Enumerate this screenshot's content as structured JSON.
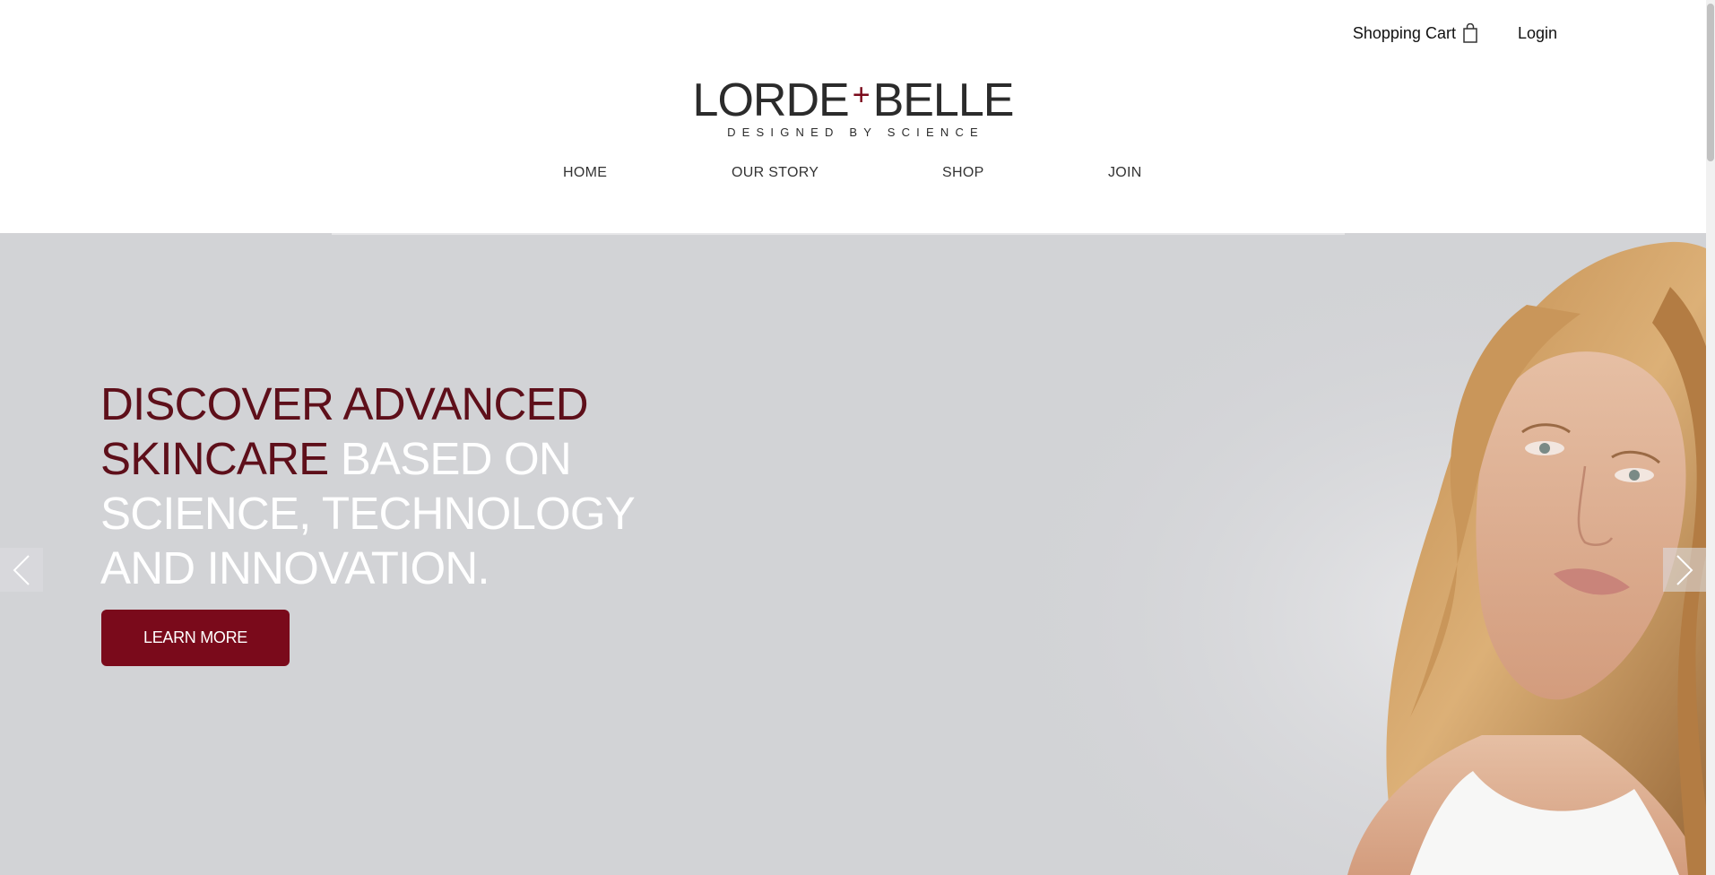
{
  "header": {
    "cart_label": "Shopping Cart",
    "login_label": "Login",
    "logo": {
      "main_left": "LORDE",
      "plus": "+",
      "main_right": "BELLE",
      "tagline": "DESIGNED BY SCIENCE"
    }
  },
  "nav": {
    "items": [
      {
        "label": "HOME"
      },
      {
        "label": "OUR STORY"
      },
      {
        "label": "SHOP"
      },
      {
        "label": "JOIN"
      }
    ]
  },
  "hero": {
    "headline_dark": "DISCOVER ADVANCED SKINCARE",
    "headline_light": " BASED ON SCIENCE, TECHNOLOGY AND INNOVATION.",
    "cta_label": "LEARN MORE"
  },
  "colors": {
    "brand": "#7a0a1b",
    "headline_dark": "#5e0f1a",
    "hero_bg": "#d2d3d6"
  },
  "icons": {
    "cart": "shopping-bag-icon",
    "prev": "chevron-left-icon",
    "next": "chevron-right-icon"
  }
}
